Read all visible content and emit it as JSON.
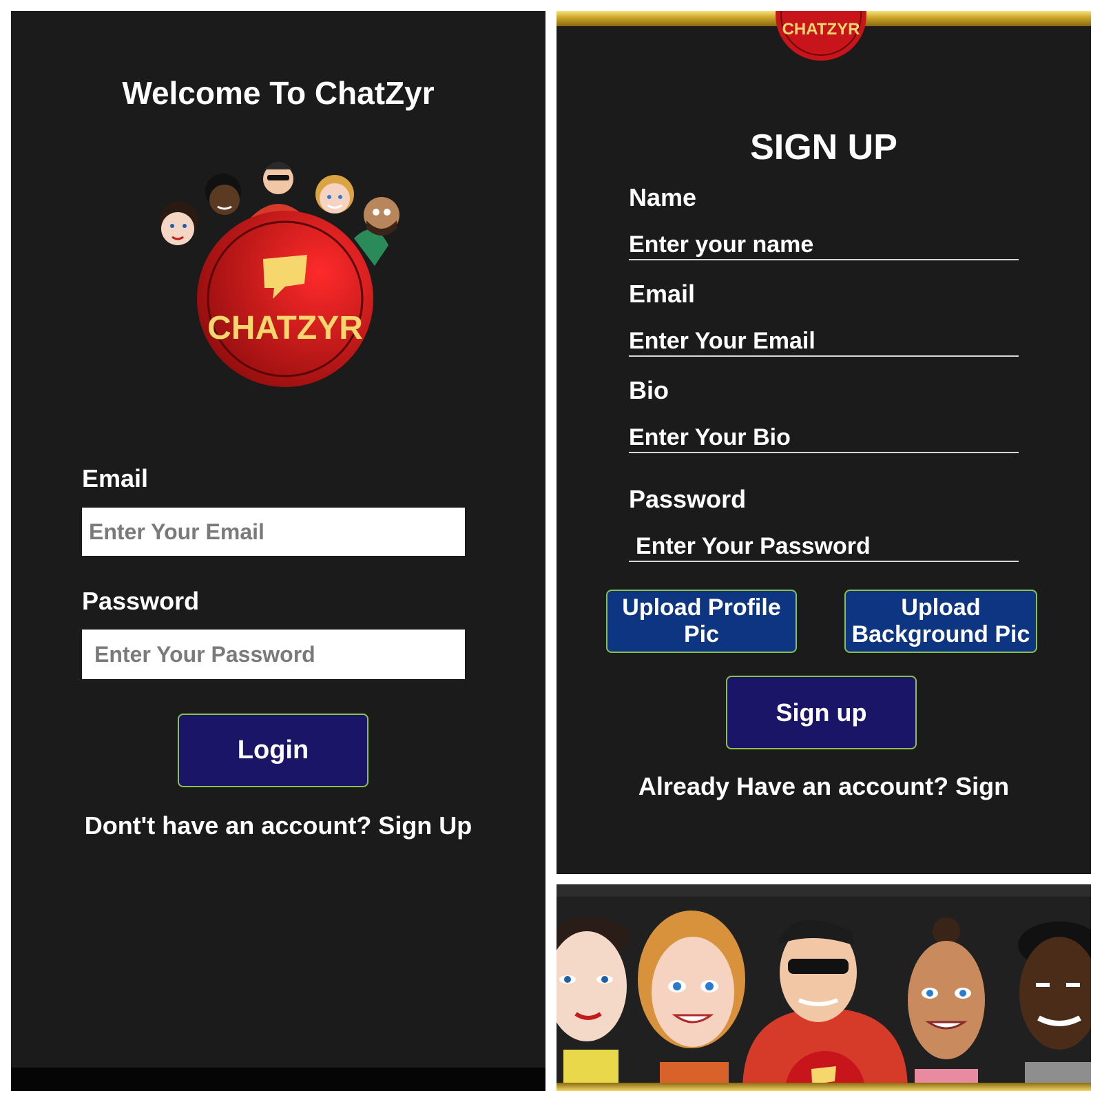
{
  "login": {
    "welcome_title": "Welcome To ChatZyr",
    "logo_text": "CHATZYR",
    "email_label": "Email",
    "email_placeholder": "Enter Your Email",
    "password_label": "Password",
    "password_placeholder": "Enter Your Password",
    "login_button": "Login",
    "signup_link": "Dont't have an account? Sign Up"
  },
  "signup": {
    "logo_text": "CHATZYR",
    "title": "SIGN UP",
    "name_label": "Name",
    "name_placeholder": "Enter your name",
    "email_label": "Email",
    "email_placeholder": "Enter Your Email",
    "bio_label": "Bio",
    "bio_placeholder": "Enter Your Bio",
    "password_label": "Password",
    "password_placeholder": "Enter Your Password",
    "upload_profile_button": "Upload Profile Pic",
    "upload_background_button": "Upload Background Pic",
    "signup_button": "Sign up",
    "signin_link": "Already Have an account? Sign"
  },
  "colors": {
    "background": "#1b1b1b",
    "navy_button": "#1a1566",
    "blue_button": "#0d3582",
    "button_border": "#8bc34a",
    "logo_red": "#d11a1a",
    "logo_gold": "#f5d76e"
  }
}
